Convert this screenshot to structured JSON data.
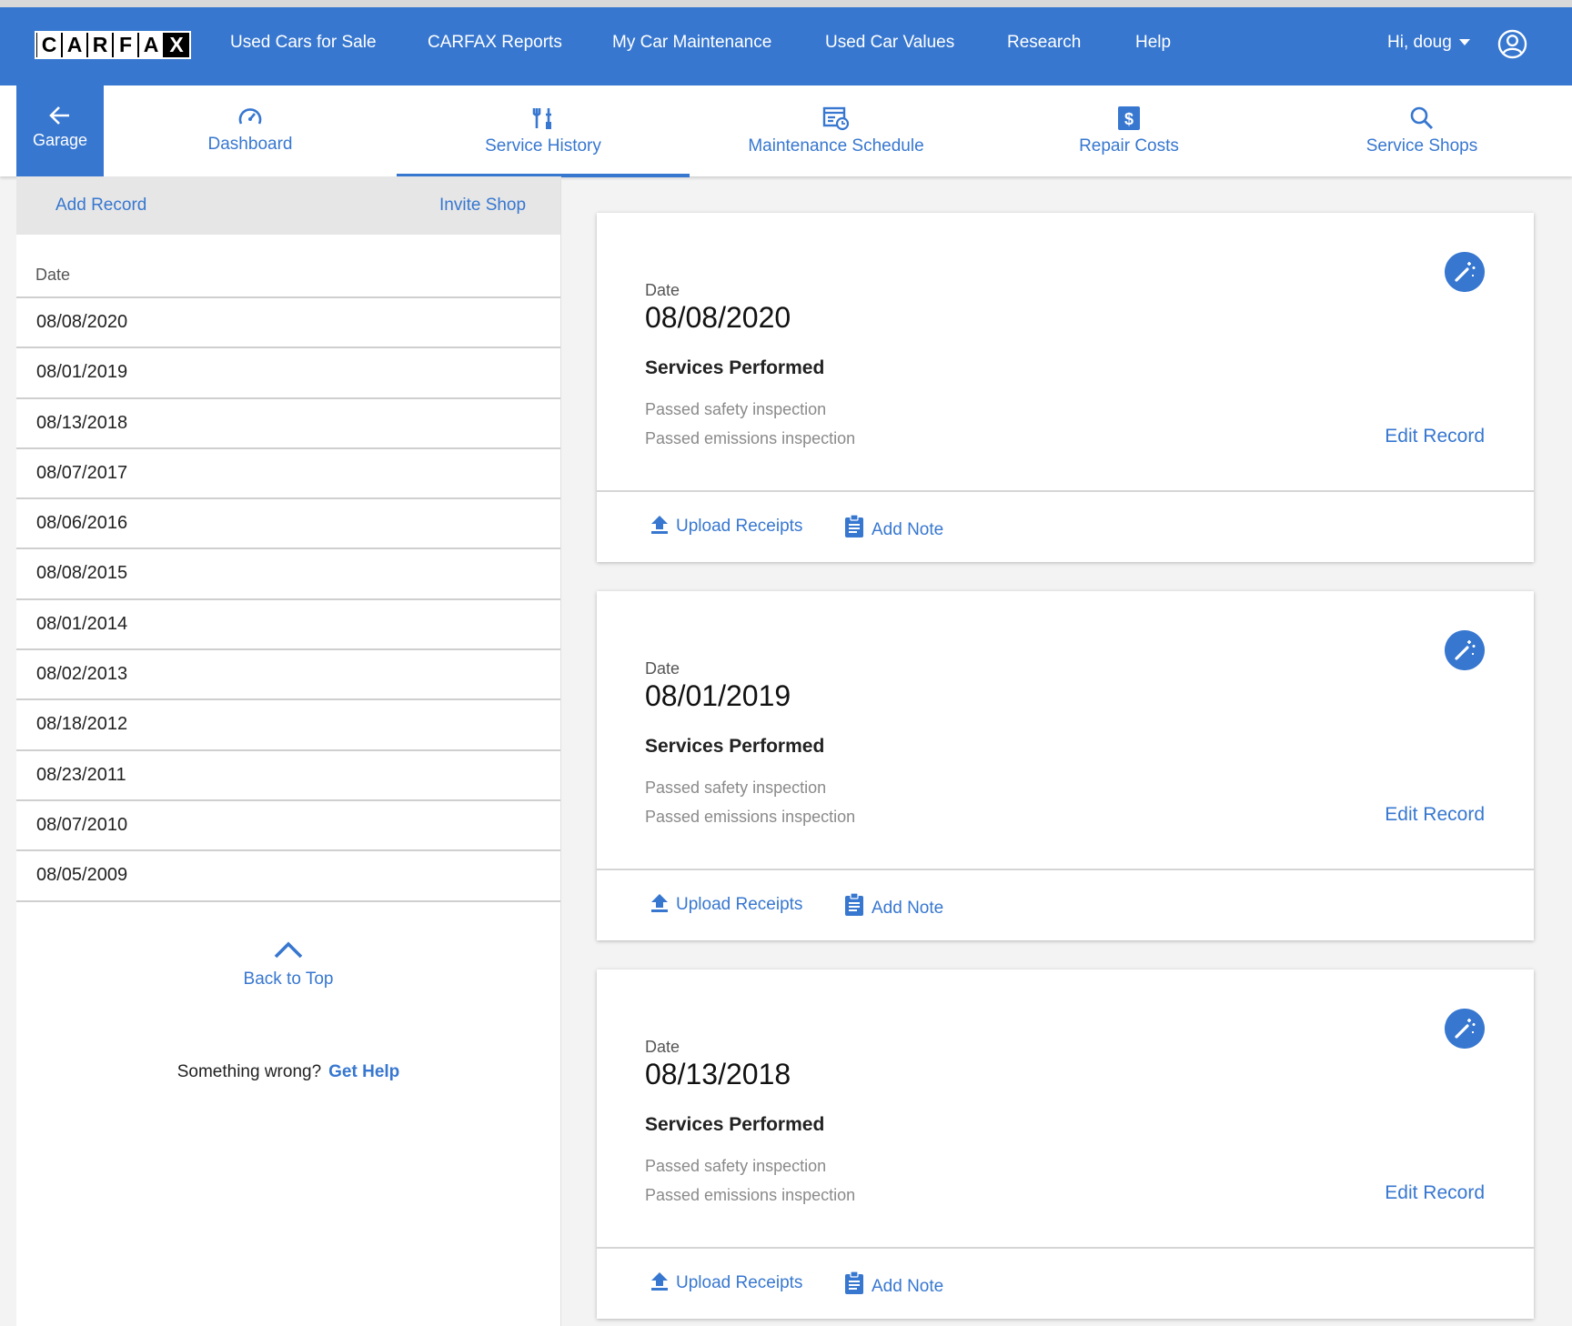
{
  "brand": {
    "letters": [
      "C",
      "A",
      "R",
      "F",
      "A",
      "X"
    ]
  },
  "topnav": [
    "Used Cars for Sale",
    "CARFAX Reports",
    "My Car Maintenance",
    "Used Car Values",
    "Research",
    "Help"
  ],
  "user": {
    "greeting": "Hi, doug"
  },
  "subnav": {
    "garage": "Garage",
    "tabs": [
      "Dashboard",
      "Service History",
      "Maintenance Schedule",
      "Repair Costs",
      "Service Shops"
    ],
    "active_tab": "Service History"
  },
  "left": {
    "add_record": "Add Record",
    "invite_shop": "Invite Shop",
    "column_header": "Date",
    "dates": [
      "08/08/2020",
      "08/01/2019",
      "08/13/2018",
      "08/07/2017",
      "08/06/2016",
      "08/08/2015",
      "08/01/2014",
      "08/02/2013",
      "08/18/2012",
      "08/23/2011",
      "08/07/2010",
      "08/05/2009"
    ],
    "back_to_top": "Back to Top",
    "something_wrong": "Something wrong?",
    "get_help": "Get Help"
  },
  "records": [
    {
      "date_label": "Date",
      "date": "08/08/2020",
      "services_heading": "Services Performed",
      "services": [
        "Passed safety inspection",
        "Passed emissions inspection"
      ],
      "edit": "Edit Record",
      "upload": "Upload Receipts",
      "note": "Add Note"
    },
    {
      "date_label": "Date",
      "date": "08/01/2019",
      "services_heading": "Services Performed",
      "services": [
        "Passed safety inspection",
        "Passed emissions inspection"
      ],
      "edit": "Edit Record",
      "upload": "Upload Receipts",
      "note": "Add Note"
    },
    {
      "date_label": "Date",
      "date": "08/13/2018",
      "services_heading": "Services Performed",
      "services": [
        "Passed safety inspection",
        "Passed emissions inspection"
      ],
      "edit": "Edit Record",
      "upload": "Upload Receipts",
      "note": "Add Note"
    }
  ],
  "colors": {
    "brand_blue": "#3777d0",
    "muted_text": "#8a8a8a"
  }
}
